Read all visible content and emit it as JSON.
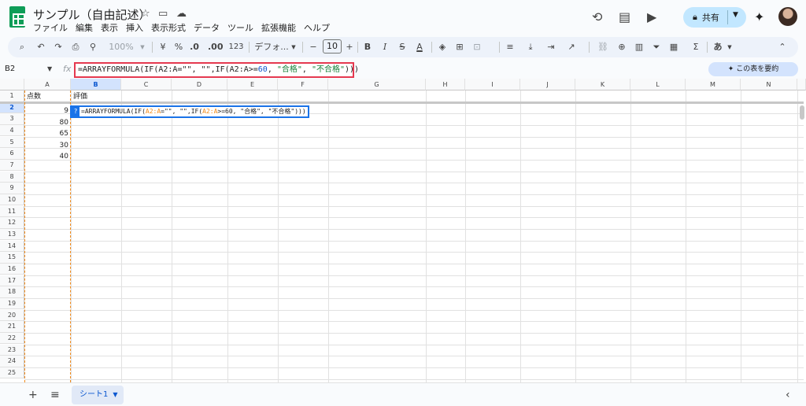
{
  "header": {
    "doc_title": "サンプル（自由記述）",
    "menu": [
      "ファイル",
      "編集",
      "表示",
      "挿入",
      "表示形式",
      "データ",
      "ツール",
      "拡張機能",
      "ヘルプ"
    ],
    "share_label": "共有"
  },
  "toolbar": {
    "zoom": "100%",
    "currency": "¥",
    "percent": "%",
    "dec_decrease": ".0",
    "dec_increase": ".00",
    "number_format": "123",
    "font": "デフォ...",
    "font_size": "10",
    "bold": "B",
    "italic": "I",
    "strike": "S",
    "text_color": "A",
    "input_tool": "あ",
    "sigma": "Σ"
  },
  "formula_bar": {
    "cell_ref": "B2",
    "fx": "fx",
    "formula_prefix": "=ARRAYFORMULA(IF(A2:A=\"\", \"\",IF(A2:A>=",
    "formula_num": "60",
    "formula_mid": ", ",
    "formula_str1": "\"合格\"",
    "formula_sep": ", ",
    "formula_str2": "\"不合格\"",
    "formula_suffix": ")))",
    "summarize_label": "この表を要約"
  },
  "grid": {
    "columns": [
      "A",
      "B",
      "C",
      "D",
      "E",
      "F",
      "G",
      "H",
      "I",
      "J",
      "K",
      "L",
      "M",
      "N"
    ],
    "selected_column": "B",
    "selected_row": 2,
    "row_count": 25,
    "header_a": "点数",
    "header_b": "評価",
    "a_values": [
      "9",
      "80",
      "65",
      "30",
      "40"
    ],
    "edit": {
      "prefix": "=ARRAYFORMULA(IF(",
      "ref1": "A2:A",
      "mid1": "=\"\", \"\",IF(",
      "ref2": "A2:A",
      "mid2": ">=60, \"合格\", \"不合格\")))",
      "badge": "?"
    }
  },
  "bottom": {
    "sheet_name": "シート1"
  }
}
